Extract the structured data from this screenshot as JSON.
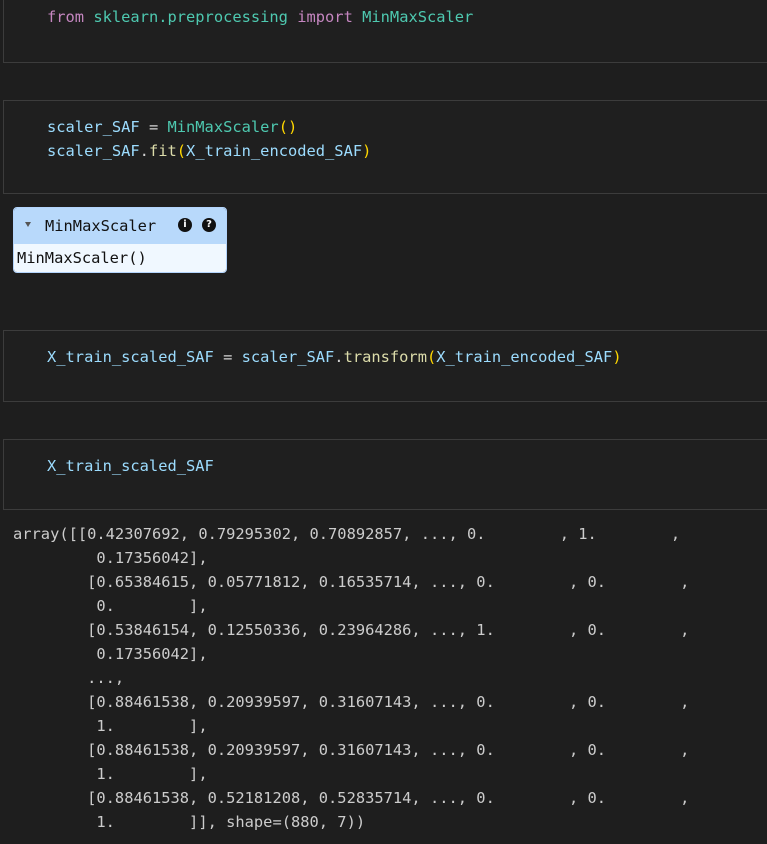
{
  "cells": [
    {
      "id": "cell-import",
      "tokens": [
        {
          "t": "from",
          "c": "kw"
        },
        {
          "t": " ",
          "c": "op"
        },
        {
          "t": "sklearn.preprocessing",
          "c": "mod"
        },
        {
          "t": " ",
          "c": "op"
        },
        {
          "t": "import",
          "c": "kw"
        },
        {
          "t": " ",
          "c": "op"
        },
        {
          "t": "MinMaxScaler",
          "c": "cls"
        }
      ]
    },
    {
      "id": "cell-fit",
      "lines": [
        [
          {
            "t": "scaler_SAF",
            "c": "var"
          },
          {
            "t": " = ",
            "c": "op"
          },
          {
            "t": "MinMaxScaler",
            "c": "cls"
          },
          {
            "t": "()",
            "c": "paren"
          }
        ],
        [
          {
            "t": "scaler_SAF",
            "c": "var"
          },
          {
            "t": ".",
            "c": "op"
          },
          {
            "t": "fit",
            "c": "fn"
          },
          {
            "t": "(",
            "c": "paren"
          },
          {
            "t": "X_train_encoded_SAF",
            "c": "var"
          },
          {
            "t": ")",
            "c": "paren"
          }
        ]
      ]
    },
    {
      "id": "cell-transform",
      "tokens": [
        {
          "t": "X_train_scaled_SAF",
          "c": "var"
        },
        {
          "t": " = ",
          "c": "op"
        },
        {
          "t": "scaler_SAF",
          "c": "var"
        },
        {
          "t": ".",
          "c": "op"
        },
        {
          "t": "transform",
          "c": "fn"
        },
        {
          "t": "(",
          "c": "paren"
        },
        {
          "t": "X_train_encoded_SAF",
          "c": "var"
        },
        {
          "t": ")",
          "c": "paren"
        }
      ]
    },
    {
      "id": "cell-display",
      "tokens": [
        {
          "t": "X_train_scaled_SAF",
          "c": "var"
        }
      ]
    }
  ],
  "widget": {
    "title": "MinMaxScaler",
    "info_badge": "i",
    "help_badge": "?",
    "repr": "MinMaxScaler()"
  },
  "output": {
    "lines": [
      "array([[0.42307692, 0.79295302, 0.70892857, ..., 0.        , 1.        ,",
      "         0.17356042],",
      "        [0.65384615, 0.05771812, 0.16535714, ..., 0.        , 0.        ,",
      "         0.        ],",
      "        [0.53846154, 0.12550336, 0.23964286, ..., 1.        , 0.        ,",
      "         0.17356042],",
      "        ...,",
      "        [0.88461538, 0.20939597, 0.31607143, ..., 0.        , 0.        ,",
      "         1.        ],",
      "        [0.88461538, 0.20939597, 0.31607143, ..., 0.        , 0.        ,",
      "         1.        ],",
      "        [0.88461538, 0.52181208, 0.52835714, ..., 0.        , 0.        ,",
      "         1.        ]], shape=(880, 7))"
    ]
  }
}
